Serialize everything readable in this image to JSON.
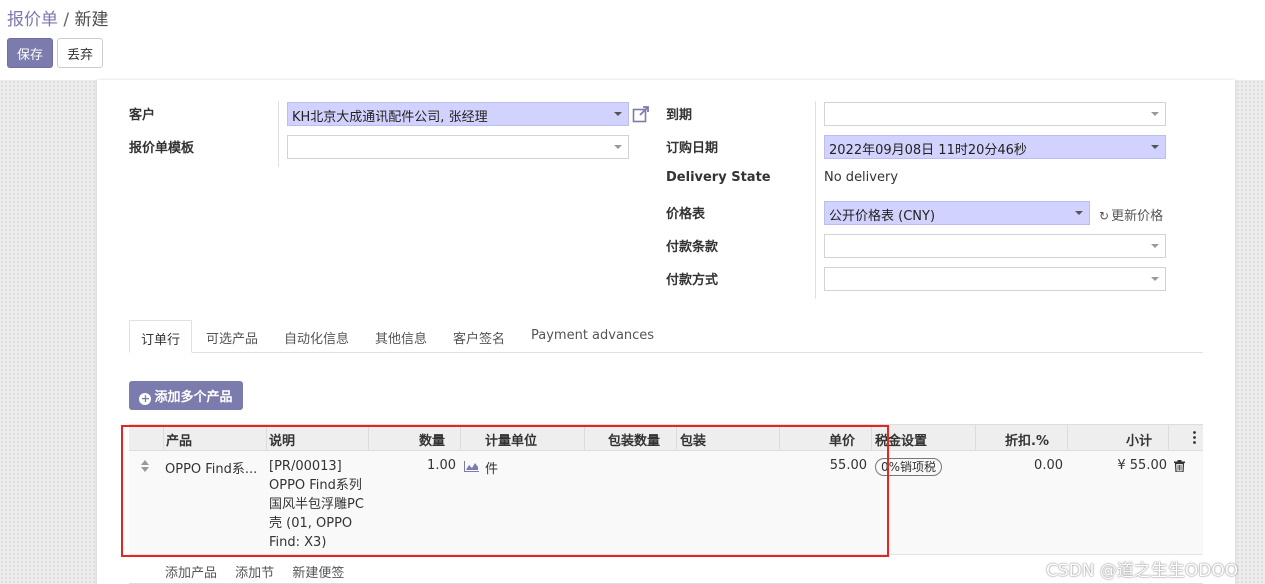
{
  "breadcrumb": {
    "parent": "报价单",
    "separator": "/",
    "current": "新建"
  },
  "actions": {
    "save": "保存",
    "discard": "丢弃"
  },
  "form": {
    "customer": {
      "label": "客户",
      "value": "KH北京大成通讯配件公司, 张经理"
    },
    "quote_template": {
      "label": "报价单模板",
      "value": ""
    },
    "expiration": {
      "label": "到期",
      "value": ""
    },
    "order_date": {
      "label": "订购日期",
      "value": "2022年09月08日 11时20分46秒"
    },
    "delivery_state": {
      "label": "Delivery State",
      "value": "No delivery"
    },
    "pricelist": {
      "label": "价格表",
      "value": "公开价格表 (CNY)",
      "update_link": "更新价格"
    },
    "payment_terms": {
      "label": "付款条款",
      "value": ""
    },
    "payment_method": {
      "label": "付款方式",
      "value": ""
    }
  },
  "tabs": [
    "订单行",
    "可选产品",
    "自动化信息",
    "其他信息",
    "客户签名",
    "Payment advances"
  ],
  "add_multiple_products": "添加多个产品",
  "table": {
    "columns": [
      "产品",
      "说明",
      "数量",
      "计量单位",
      "包装数量",
      "包装",
      "单价",
      "税金设置",
      "折扣.%",
      "小计"
    ],
    "rows": [
      {
        "product": "OPPO Find系...",
        "description": [
          "[PR/00013]",
          "OPPO Find系列",
          "国风半包浮雕PC",
          "壳 (01, OPPO",
          "Find: X3)"
        ],
        "quantity": "1.00",
        "uom": "件",
        "packaging_qty": "",
        "packaging": "",
        "unit_price": "55.00",
        "tax": "0%销项税",
        "discount": "0.00",
        "subtotal": "¥ 55.00"
      }
    ]
  },
  "add_links": {
    "add_product": "添加产品",
    "add_section": "添加节",
    "add_note": "新建便签"
  },
  "watermark": "CSDN @道之生生ODOO",
  "colors": {
    "primary": "#7c7bad",
    "filled_field": "#d2d2ff",
    "highlight_box": "#e8241f"
  }
}
